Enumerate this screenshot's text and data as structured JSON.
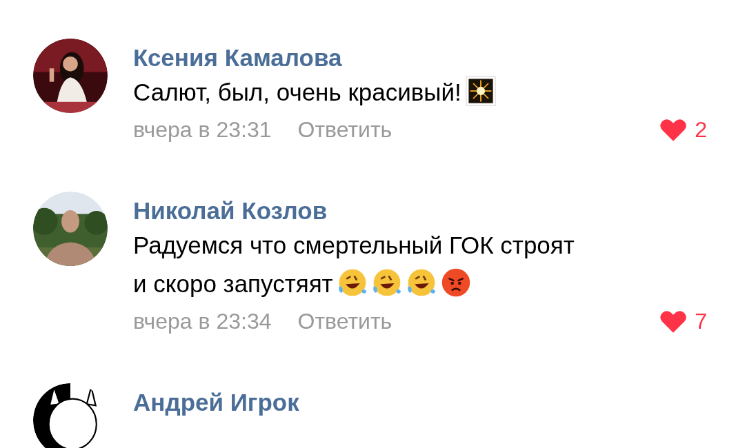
{
  "comments": [
    {
      "author": "Ксения Камалова",
      "avatar": {
        "kind": "picture"
      },
      "body": [
        {
          "kind": "text",
          "text": "Салют, был, очень красивый!"
        },
        {
          "kind": "fireworks"
        }
      ],
      "time": "вчера в 23:31",
      "reply": "Ответить",
      "likes": {
        "count": "2",
        "liked": true
      }
    },
    {
      "author": "Николай Козлов",
      "avatar": {
        "kind": "picture"
      },
      "body": [
        {
          "kind": "text",
          "text": "Радуемся что смертельный ГОК строят"
        },
        {
          "kind": "break"
        },
        {
          "kind": "text",
          "text": "и скоро запустяят"
        },
        {
          "kind": "laughing"
        },
        {
          "kind": "laughing"
        },
        {
          "kind": "laughing"
        },
        {
          "kind": "angry"
        }
      ],
      "time": "вчера в 23:34",
      "reply": "Ответить",
      "likes": {
        "count": "7",
        "liked": true
      }
    },
    {
      "author": "Андрей Игрок",
      "avatar": {
        "kind": "picture"
      }
    }
  ]
}
